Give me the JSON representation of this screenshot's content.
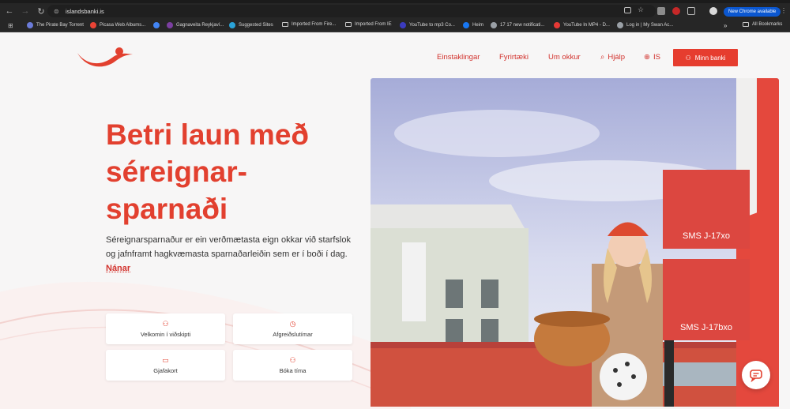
{
  "browser": {
    "url": "islandsbanki.is",
    "update_label": "New Chrome available",
    "bookmarks": [
      {
        "label": "The Pirate Bay Torrent",
        "icon": "pirate-icon",
        "color": "#6b7bd8"
      },
      {
        "label": "Picasa Web Albums...",
        "icon": "google-icon",
        "color": "#ea4335"
      },
      {
        "label": "",
        "icon": "google-icon",
        "color": "#4285f4"
      },
      {
        "label": "Gagnaveita Reykjaví...",
        "icon": "site-icon",
        "color": "#7b3fa0"
      },
      {
        "label": "Suggested Sites",
        "icon": "bing-icon",
        "color": "#2aa3d8"
      },
      {
        "label": "Imported From Fire...",
        "icon": "folder-icon",
        "color": ""
      },
      {
        "label": "Imported From IE",
        "icon": "folder-icon",
        "color": ""
      },
      {
        "label": "YouTube to mp3 Co...",
        "icon": "site-icon",
        "color": "#3b3bbf"
      },
      {
        "label": "Heim",
        "icon": "facebook-icon",
        "color": "#1877f2"
      },
      {
        "label": "17 17 new notificati...",
        "icon": "globe-icon",
        "color": "#9aa0a6"
      },
      {
        "label": "YouTube In MP4 - D...",
        "icon": "youtube-icon",
        "color": "#e53935"
      },
      {
        "label": "Log in | My Swan Ac...",
        "icon": "globe-icon",
        "color": "#9aa0a6"
      }
    ],
    "all_bookmarks": "All Bookmarks"
  },
  "site": {
    "nav": {
      "individuals": "Einstaklingar",
      "companies": "Fyrirtæki",
      "about": "Um okkur",
      "help": "Hjálp",
      "language": "IS",
      "my_bank": "Minn banki"
    },
    "hero": {
      "line1": "Betri laun með",
      "line2": "séreignar-",
      "line3": "sparnaði",
      "lead": "Séreignarsparnaður er ein verðmætasta eign okkar við starfslok og jafnframt hagkvæmasta sparnaðarleiðin sem er í boði í dag.",
      "more_link": "Nánar"
    },
    "cards": [
      {
        "label": "Velkomin í viðskipti",
        "icon": "user-plus-icon"
      },
      {
        "label": "Afgreiðslutímar",
        "icon": "clock-icon"
      },
      {
        "label": "Gjafakort",
        "icon": "gift-card-icon"
      },
      {
        "label": "Bóka tíma",
        "icon": "user-calendar-icon"
      }
    ],
    "sms_boxes": [
      "SMS J-17xo",
      "SMS J-17bxo"
    ],
    "colors": {
      "brand": "#e2402f",
      "button": "#e63d2f",
      "sms_box": "#dc4740"
    }
  }
}
